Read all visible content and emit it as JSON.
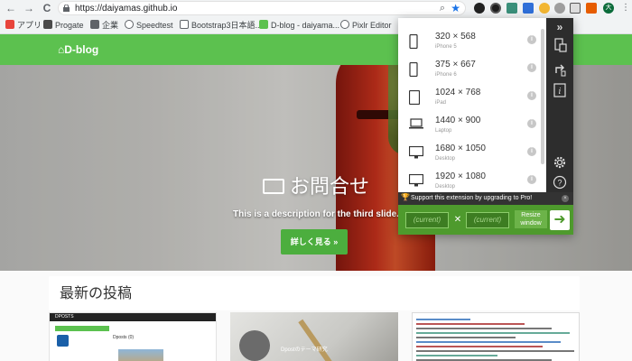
{
  "browser": {
    "url": "https://daiyamas.github.io",
    "back_glyph": "←",
    "forward_glyph": "→",
    "reload_glyph": "C",
    "profile_initials": "大"
  },
  "bookmarks": [
    {
      "label": "アプリ",
      "icon": "apps-grid-icon",
      "color": "#e8453c"
    },
    {
      "label": "Progate",
      "icon": "progate-icon",
      "color": "#4b4b4b"
    },
    {
      "label": "企業",
      "icon": "folder-icon",
      "color": "#5f6368"
    },
    {
      "label": "Speedtest",
      "icon": "speedtest-icon",
      "color": "#5f6368"
    },
    {
      "label": "Bootstrap3日本語...",
      "icon": "page-icon",
      "color": "#5f6368"
    },
    {
      "label": "D-blog - daiyama...",
      "icon": "page-icon",
      "color": "#5cc14f"
    },
    {
      "label": "Pixlr Editor",
      "icon": "pixlr-icon",
      "color": "#5f6368"
    }
  ],
  "site": {
    "brand": "D-blog",
    "hero_title": "お問合せ",
    "hero_description": "This is a description for the third slide.",
    "hero_button": "詳しく見る »",
    "section_title": "最新の投稿",
    "card1_bar": "DPOSTS",
    "card1_label": "Dposts (0)",
    "card2_text": "Dpostのテーマ研究"
  },
  "extension": {
    "presets": [
      {
        "size": "320 × 568",
        "device": "iPhone 5",
        "icon": "phone-icon"
      },
      {
        "size": "375 × 667",
        "device": "iPhone 6",
        "icon": "phone-icon"
      },
      {
        "size": "1024 × 768",
        "device": "iPad",
        "icon": "tablet-icon"
      },
      {
        "size": "1440 × 900",
        "device": "Laptop",
        "icon": "laptop-icon"
      },
      {
        "size": "1680 × 1050",
        "device": "Desktop",
        "icon": "desktop-icon"
      },
      {
        "size": "1920 × 1080",
        "device": "Desktop",
        "icon": "desktop-icon"
      }
    ],
    "promo": "Support this extension by upgrading to Pro!",
    "width_placeholder": "(current)",
    "height_placeholder": "(current)",
    "times": "✕",
    "resize_label": "Resize window",
    "collapse_glyph": "»"
  }
}
